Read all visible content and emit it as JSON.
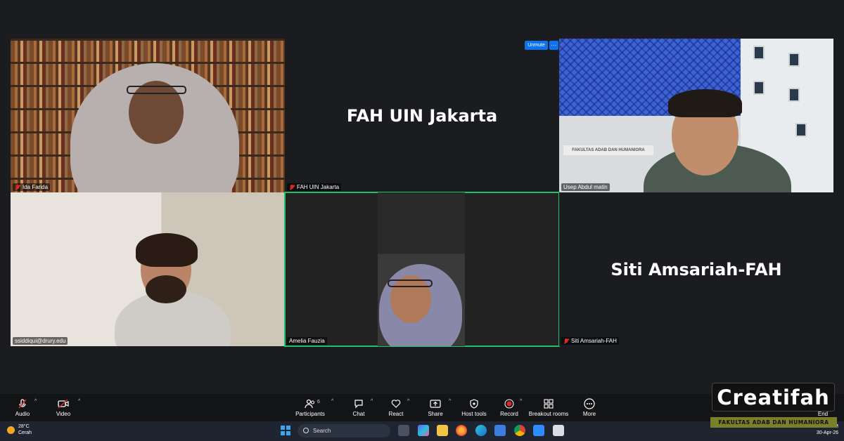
{
  "participants": [
    {
      "name": "Ida Farida",
      "muted": true
    },
    {
      "name": "FAH UIN Jakarta",
      "muted": true,
      "display_name": "FAH UIN Jakarta"
    },
    {
      "name": "Usep Abdul matin",
      "muted": false
    },
    {
      "name": "ssiddiqui@drury.edu",
      "muted": false
    },
    {
      "name": "Amelia Fauzia",
      "muted": false,
      "active_speaker": true
    },
    {
      "name": "Siti Amsariah-FAH",
      "muted": true,
      "display_name": "Siti Amsariah-FAH"
    }
  ],
  "building_sign": "FAKULTAS ADAB DAN HUMANIORA",
  "tile_controls": {
    "unmute": "Unmute",
    "more": "···"
  },
  "toolbar": {
    "audio": "Audio",
    "video": "Video",
    "participants": "Participants",
    "participants_count": "6",
    "chat": "Chat",
    "react": "React",
    "share": "Share",
    "host_tools": "Host tools",
    "record": "Record",
    "breakout_rooms": "Breakout rooms",
    "more": "More",
    "end": "End"
  },
  "taskbar": {
    "temperature": "28°C",
    "weather": "Cerah",
    "search_placeholder": "Search",
    "time": "8:37 AM",
    "date": "30-Apr-26"
  },
  "watermark": {
    "title": "Creatifah",
    "subtitle": "FAKULTAS ADAB DAN HUMANIORA"
  },
  "colors": {
    "active_speaker_border": "#1dc267",
    "unmute_button": "#0e72ed",
    "record_dot": "#e02828",
    "end_button": "#e02828"
  }
}
